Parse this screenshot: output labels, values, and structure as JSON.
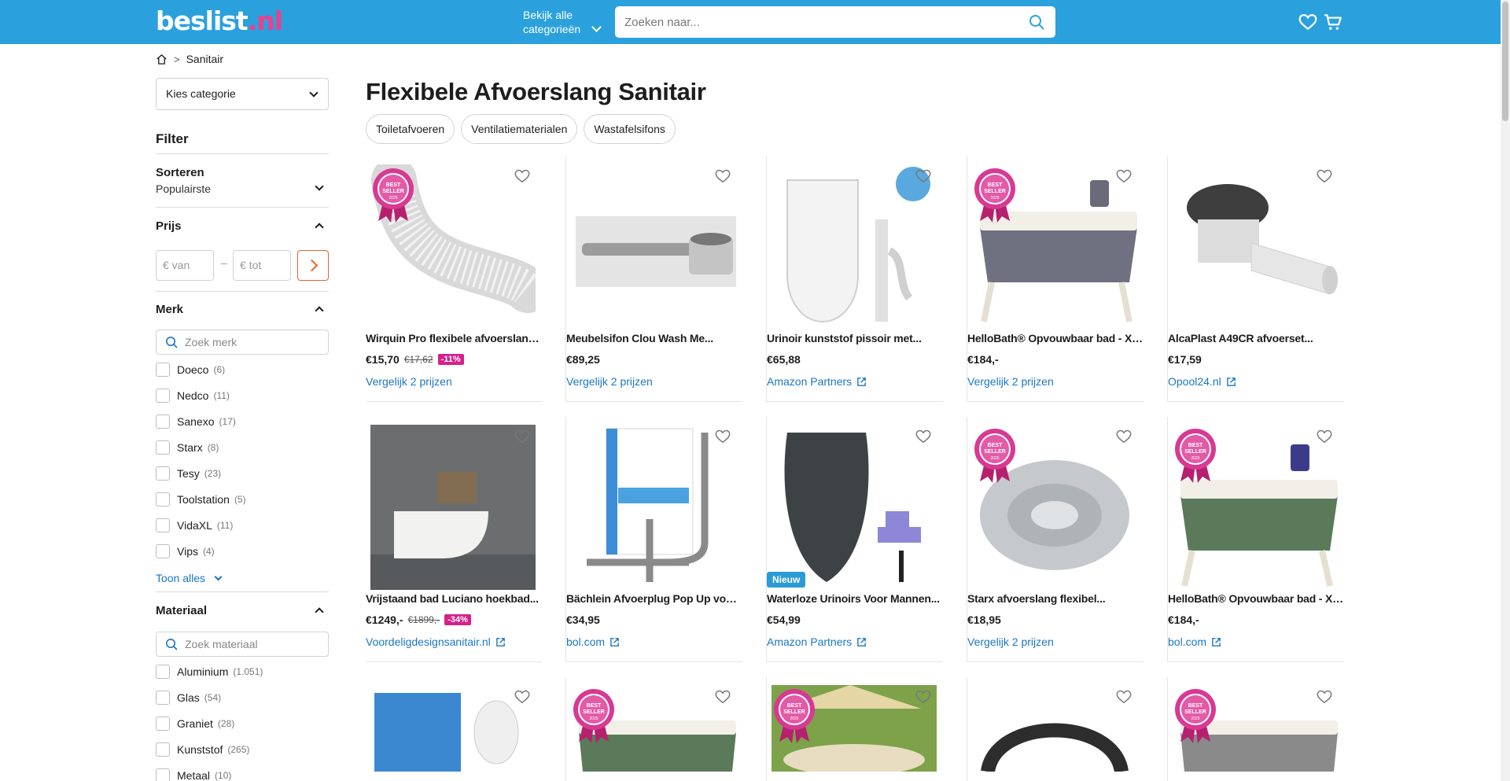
{
  "header": {
    "logo_main": "beslist",
    "logo_dot": ".",
    "logo_tld": "nl",
    "categories_line1": "Bekijk alle",
    "categories_line2": "categorieën",
    "search_placeholder": "Zoeken naar...",
    "brand_color": "#2aa1dd",
    "accent_color": "#ee3e8e"
  },
  "breadcrumb": {
    "current": "Sanitair"
  },
  "sidebar": {
    "select_label": "Kies categorie",
    "filter_title": "Filter",
    "sort_title": "Sorteren",
    "sort_value": "Populairste",
    "price_title": "Prijs",
    "price_from": "€  van",
    "price_to": "€  tot",
    "price_dash": "–",
    "brand_title": "Merk",
    "brand_search": "Zoek merk",
    "brands": [
      {
        "label": "Doeco",
        "count": "(6)"
      },
      {
        "label": "Nedco",
        "count": "(11)"
      },
      {
        "label": "Sanexo",
        "count": "(17)"
      },
      {
        "label": "Starx",
        "count": "(8)"
      },
      {
        "label": "Tesy",
        "count": "(23)"
      },
      {
        "label": "Toolstation",
        "count": "(5)"
      },
      {
        "label": "VidaXL",
        "count": "(11)"
      },
      {
        "label": "Vips",
        "count": "(4)"
      }
    ],
    "show_all": "Toon alles",
    "material_title": "Materiaal",
    "material_search": "Zoek materiaal",
    "materials": [
      {
        "label": "Aluminium",
        "count": "(1.051)"
      },
      {
        "label": "Glas",
        "count": "(54)"
      },
      {
        "label": "Graniet",
        "count": "(28)"
      },
      {
        "label": "Kunststof",
        "count": "(265)"
      },
      {
        "label": "Metaal",
        "count": "(10)"
      }
    ]
  },
  "main": {
    "title": "Flexibele Afvoerslang Sanitair",
    "chips": [
      "Toiletafvoeren",
      "Ventilatiematerialen",
      "Wastafelsifons"
    ],
    "products": [
      {
        "name": "Wirquin Pro flexibele afvoerslang...",
        "price": "€15,70",
        "old_price": "€17,62",
        "discount": "-11%",
        "link": "Vergelijk 2 prijzen",
        "external": false,
        "best": true,
        "new_badge": ""
      },
      {
        "name": "Meubelsifon Clou Wash Me...",
        "price": "€89,25",
        "old_price": "",
        "discount": "",
        "link": "Vergelijk 2 prijzen",
        "external": false,
        "best": false,
        "new_badge": ""
      },
      {
        "name": "Urinoir kunststof pissoir met...",
        "price": "€65,88",
        "old_price": "",
        "discount": "",
        "link": "Amazon Partners",
        "external": true,
        "best": false,
        "new_badge": ""
      },
      {
        "name": "HelloBath® Opvouwbaar bad - XX...",
        "price": "€184,-",
        "old_price": "",
        "discount": "",
        "link": "Vergelijk 2 prijzen",
        "external": false,
        "best": true,
        "new_badge": ""
      },
      {
        "name": "AlcaPlast A49CR afvoerset...",
        "price": "€17,59",
        "old_price": "",
        "discount": "",
        "link": "Opool24.nl",
        "external": true,
        "best": false,
        "new_badge": ""
      },
      {
        "name": "Vrijstaand bad Luciano hoekbad...",
        "price": "€1249,-",
        "old_price": "€1899,-",
        "discount": "-34%",
        "link": "Voordeligdesignsanitair.nl",
        "external": true,
        "best": false,
        "new_badge": ""
      },
      {
        "name": "Bächlein Afvoerplug Pop Up voor...",
        "price": "€34,95",
        "old_price": "",
        "discount": "",
        "link": "bol.com",
        "external": true,
        "best": false,
        "new_badge": ""
      },
      {
        "name": "Waterloze Urinoirs Voor Mannen...",
        "price": "€54,99",
        "old_price": "",
        "discount": "",
        "link": "Amazon Partners",
        "external": true,
        "best": false,
        "new_badge": "Nieuw"
      },
      {
        "name": "Starx afvoerslang flexibel...",
        "price": "€18,95",
        "old_price": "",
        "discount": "",
        "link": "Vergelijk 2 prijzen",
        "external": false,
        "best": true,
        "new_badge": ""
      },
      {
        "name": "HelloBath® Opvouwbaar bad - XX...",
        "price": "€184,-",
        "old_price": "",
        "discount": "",
        "link": "bol.com",
        "external": true,
        "best": true,
        "new_badge": ""
      }
    ],
    "best_seller_text": "BEST SELLER",
    "best_seller_year": "2025"
  }
}
